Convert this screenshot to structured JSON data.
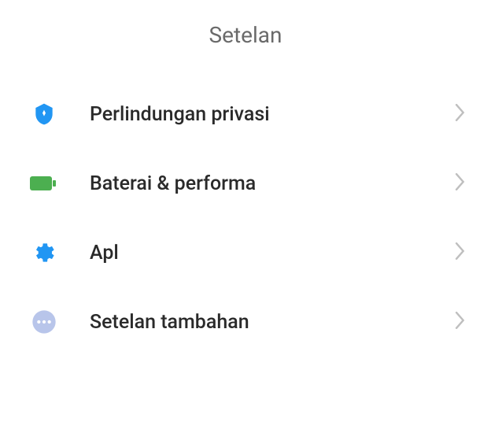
{
  "header": {
    "title": "Setelan"
  },
  "menu": {
    "items": [
      {
        "label": "Perlindungan privasi",
        "icon": "shield"
      },
      {
        "label": "Baterai & performa",
        "icon": "battery"
      },
      {
        "label": "Apl",
        "icon": "gear"
      },
      {
        "label": "Setelan tambahan",
        "icon": "dots"
      }
    ]
  }
}
